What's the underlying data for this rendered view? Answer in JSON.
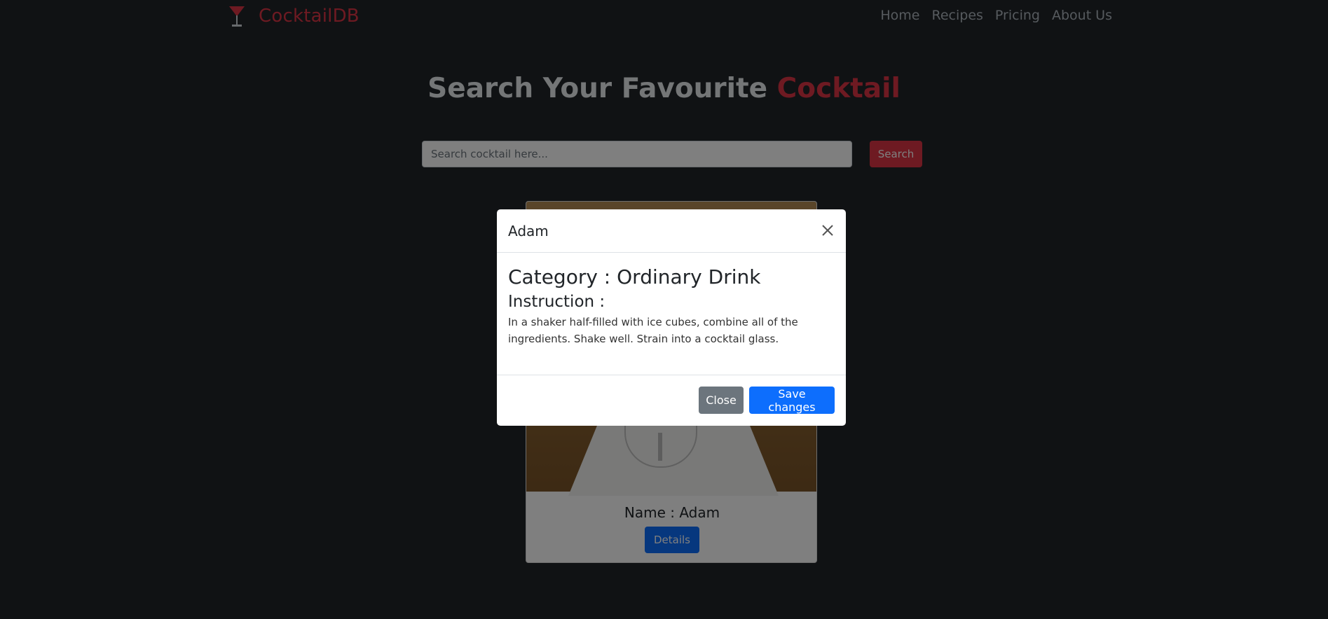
{
  "navbar": {
    "brand": "CocktailDB",
    "links": [
      "Home",
      "Recipes",
      "Pricing",
      "About Us"
    ]
  },
  "hero": {
    "title_main": "Search Your Favourite",
    "title_accent": "Cocktail"
  },
  "search": {
    "placeholder": "Search cocktail here...",
    "button_label": "Search"
  },
  "card": {
    "name": "Name : Adam",
    "details_label": "Details"
  },
  "modal": {
    "title": "Adam",
    "category": "Category : Ordinary Drink",
    "instruction_heading": "Instruction :",
    "instruction_text": "In a shaker half-filled with ice cubes, combine all of the ingredients. Shake well. Strain into a cocktail glass.",
    "close_label": "Close",
    "save_label": "Save changes"
  },
  "colors": {
    "background": "#212529",
    "accent": "#dc3545",
    "primary": "#0d6efd",
    "secondary": "#6c757d"
  },
  "icons": {
    "brand": "cocktail-glass-icon",
    "close": "close-icon"
  }
}
